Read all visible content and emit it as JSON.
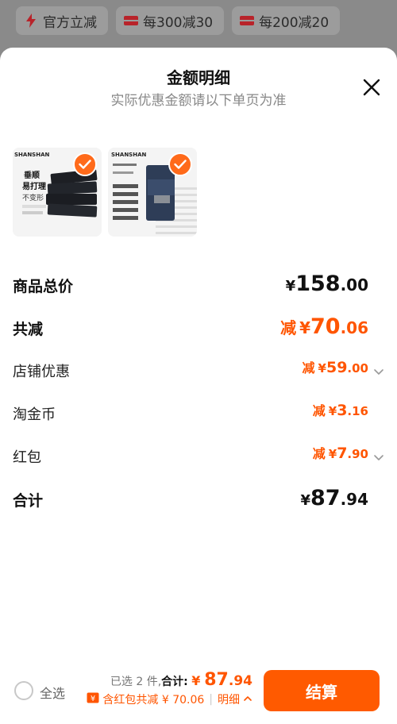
{
  "promo": {
    "chips": [
      {
        "icon": "lightning-icon",
        "label": "官方立减"
      },
      {
        "icon": "coupon-icon",
        "label": "每300减30"
      },
      {
        "icon": "coupon-icon",
        "label": "每200减20"
      }
    ]
  },
  "sheet": {
    "title": "金额明细",
    "subtitle": "实际优惠金额请以下单页为准",
    "products": [
      {
        "brand": "SHANSHAN",
        "tag1": "垂顺",
        "tag2": "易打理",
        "tag3": "不变形",
        "selected": true
      },
      {
        "brand": "SHANSHAN",
        "selected": true
      }
    ],
    "rows": [
      {
        "label": "商品总价",
        "prefix": "",
        "yen": "¥",
        "int": "158",
        "dec": ".00",
        "style": "black-lg",
        "chevron": false
      },
      {
        "label": "共减",
        "prefix": "减",
        "yen": "¥",
        "int": "70",
        "dec": ".06",
        "style": "orange-lg",
        "chevron": false
      },
      {
        "label": "店铺优惠",
        "prefix": "减",
        "yen": "¥",
        "int": "59",
        "dec": ".00",
        "style": "orange-md",
        "chevron": true
      },
      {
        "label": "淘金币",
        "prefix": "减",
        "yen": "¥",
        "int": "3",
        "dec": ".16",
        "style": "orange-md",
        "chevron": false
      },
      {
        "label": "红包",
        "prefix": "减",
        "yen": "¥",
        "int": "7",
        "dec": ".90",
        "style": "orange-md",
        "chevron": true
      },
      {
        "label": "合计",
        "prefix": "",
        "yen": "¥",
        "int": "87",
        "dec": ".94",
        "style": "black-lg",
        "chevron": false
      }
    ]
  },
  "bottom": {
    "select_all": "全选",
    "selected_text": "已选 2 件,",
    "total_label": "合计:",
    "total_yen": "¥",
    "total_int": "87",
    "total_dec": ".94",
    "discount_text": "含红包共减 ¥ 70.06",
    "separator": "|",
    "detail_label": "明细",
    "checkout_label": "结算"
  },
  "colors": {
    "accent": "#ff5500",
    "button": "#ff5a00",
    "check": "#ff6a1a"
  }
}
